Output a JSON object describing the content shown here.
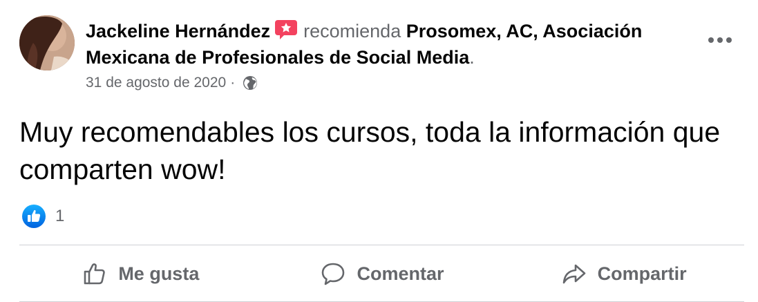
{
  "post": {
    "author": "Jackeline Hernández",
    "verb": "recomienda",
    "page_name": "Prosomex, AC, Asociación Mexicana de Profesionales de Social Media",
    "period": ".",
    "date": "31 de agosto de 2020",
    "separator": "·",
    "audience_icon": "globe-icon",
    "recommend_icon": "recommendation-star-icon",
    "body": "Muy recomendables los cursos, toda la información que comparten wow!",
    "reaction_icon": "like-reaction-icon",
    "reaction_count": "1"
  },
  "actions": {
    "like_label": "Me gusta",
    "comment_label": "Comentar",
    "share_label": "Compartir"
  },
  "colors": {
    "text_primary": "#050505",
    "text_secondary": "#65676b",
    "recommend_badge": "#f3425f",
    "like_blue": "#1877f2",
    "divider": "#ced0d4"
  }
}
